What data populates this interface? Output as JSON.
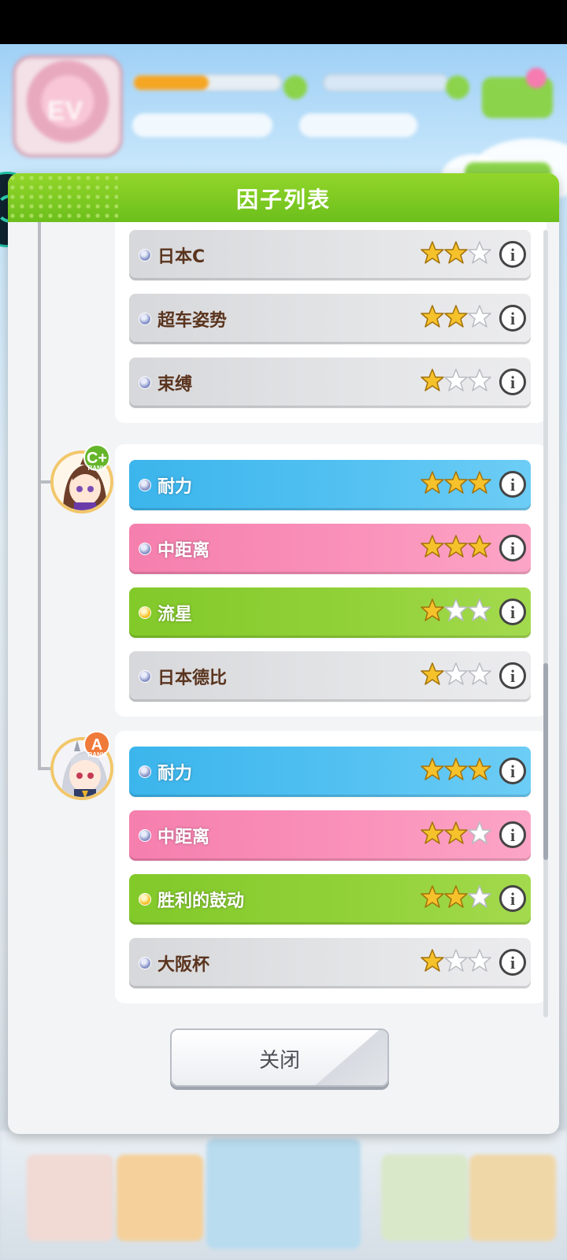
{
  "dialog": {
    "title": "因子列表",
    "close_label": "关闭"
  },
  "groups": [
    {
      "factors": [
        {
          "name": "日本C",
          "color": "gray",
          "dot": "blue",
          "stars": 2
        },
        {
          "name": "超车姿势",
          "color": "gray",
          "dot": "blue",
          "stars": 2
        },
        {
          "name": "束缚",
          "color": "gray",
          "dot": "blue",
          "stars": 1
        }
      ]
    },
    {
      "rank": "C+",
      "rank_sub": "RANK",
      "factors": [
        {
          "name": "耐力",
          "color": "blue",
          "dot": "blue",
          "stars": 3
        },
        {
          "name": "中距离",
          "color": "pink",
          "dot": "blue",
          "stars": 3
        },
        {
          "name": "流星",
          "color": "green",
          "dot": "gold",
          "stars": 1
        },
        {
          "name": "日本德比",
          "color": "gray",
          "dot": "blue",
          "stars": 1
        }
      ]
    },
    {
      "rank": "A",
      "rank_sub": "RANK",
      "factors": [
        {
          "name": "耐力",
          "color": "blue",
          "dot": "blue",
          "stars": 3
        },
        {
          "name": "中距离",
          "color": "pink",
          "dot": "blue",
          "stars": 2
        },
        {
          "name": "胜利的鼓动",
          "color": "green",
          "dot": "gold",
          "stars": 2
        },
        {
          "name": "大阪杯",
          "color": "gray",
          "dot": "blue",
          "stars": 1
        }
      ]
    }
  ],
  "colors": {
    "header_green": "#7cc920",
    "star_gold": "#f6c22c",
    "text_brown": "#5a341e"
  },
  "icons": [
    "info-icon",
    "star-icon",
    "bullet-dot-icon"
  ]
}
